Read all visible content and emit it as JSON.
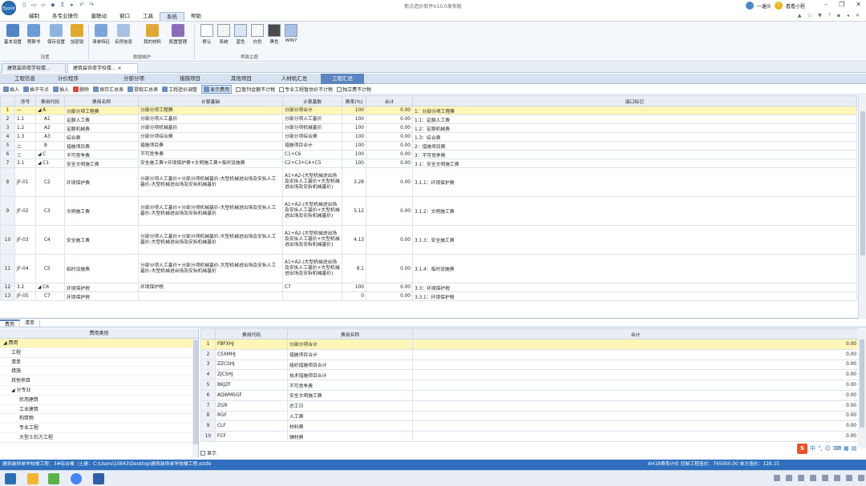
{
  "window": {
    "title": "新点造价软件V10.0发布版",
    "logo_text": "Epoint",
    "user_name": "一遍头",
    "help_label": "看看小程",
    "qat_icons": [
      "new-icon",
      "open-icon",
      "folder-icon",
      "save-icon",
      "sigma-icon",
      "export-icon",
      "undo-icon",
      "redo-icon"
    ]
  },
  "menu": {
    "items": [
      {
        "label": "编制",
        "active": false
      },
      {
        "label": "各专业操作",
        "active": false
      },
      {
        "label": "量联动",
        "active": false
      },
      {
        "label": "窗口",
        "active": false
      },
      {
        "label": "工具",
        "active": false
      },
      {
        "label": "系统",
        "active": true
      },
      {
        "label": "帮助",
        "active": false
      }
    ],
    "right": [
      "▲",
      "◇",
      "▼",
      "?",
      "▪",
      "◂",
      "✕"
    ]
  },
  "ribbon": {
    "groups": [
      {
        "label": "设置",
        "buttons": [
          "基本设置",
          "预算书",
          "保存设置",
          "加密锁"
        ]
      },
      {
        "label": "数据维护",
        "buttons": [
          "清单特征",
          "名称信息",
          "我的材料",
          "配置管理"
        ]
      },
      {
        "label": "界面主题",
        "buttons": [
          "默认",
          "系统",
          "蓝色",
          "白色",
          "黑色",
          "WIN7"
        ]
      }
    ],
    "theme_colors": [
      "#ffffff",
      "#f3f3f3",
      "#dbe6f4",
      "#f7f7f7",
      "#4a4a4a",
      "#a9c3e8"
    ]
  },
  "doc_tabs": [
    {
      "label": "建筑装饰单学校楼...",
      "active": false
    },
    {
      "label": "建筑装饰单学校楼...",
      "active": true,
      "close": "×"
    }
  ],
  "sub_tabs": [
    {
      "label": "工程信息",
      "active": false
    },
    {
      "label": "计价程序",
      "active": false
    },
    {
      "label": "分部分项",
      "active": false
    },
    {
      "label": "措施项目",
      "active": false
    },
    {
      "label": "其他项目",
      "active": false
    },
    {
      "label": "人材机汇总",
      "active": false
    },
    {
      "label": "工程汇总",
      "active": true
    }
  ],
  "toolbar2": {
    "buttons": [
      "插入",
      "插子节点",
      "插入",
      "删除",
      "保存汇总表",
      "提取汇总表",
      "工程造价调整",
      "显示费用"
    ],
    "checks": [
      "暂列金额不计税",
      "专业工程暂估价不计税",
      "独立费不计税"
    ]
  },
  "summary_grid": {
    "headers": [
      "序号",
      "费用代码",
      "费用名称",
      "计算基础",
      "计算基数",
      "费率(%)",
      "合计",
      "接口标记"
    ],
    "rows": [
      {
        "rn": "1",
        "seq": "—",
        "code": "◢ A",
        "name": "分部分项工程费",
        "basis": "分部分项工程费",
        "base": "分部分项合计",
        "rate": "100",
        "total": "0.00",
        "mark": "1：分部分项工程费",
        "sel": true,
        "tall": false
      },
      {
        "rn": "2",
        "seq": "1.1",
        "code": "A1",
        "name": "定额人工费",
        "basis": "分部分项人工基价",
        "base": "分部分项人工基价",
        "rate": "100",
        "total": "0.00",
        "mark": "1.1：定额人工费",
        "sel": false,
        "tall": false
      },
      {
        "rn": "3",
        "seq": "1.2",
        "code": "A2",
        "name": "定额机械费",
        "basis": "分部分项机械基价",
        "base": "分部分项机械基价",
        "rate": "100",
        "total": "0.00",
        "mark": "1.2：定额机械费",
        "sel": false,
        "tall": false
      },
      {
        "rn": "4",
        "seq": "1.3",
        "code": "A3",
        "name": "综合费",
        "basis": "分部分项综合费",
        "base": "分部分项综合费",
        "rate": "100",
        "total": "0.00",
        "mark": "1.3：综合费",
        "sel": false,
        "tall": false
      },
      {
        "rn": "5",
        "seq": "二",
        "code": "B",
        "name": "措施项目费",
        "basis": "措施项目费",
        "base": "措施项目合计",
        "rate": "100",
        "total": "0.00",
        "mark": "2：措施项目费",
        "sel": false,
        "tall": false
      },
      {
        "rn": "6",
        "seq": "三",
        "code": "◢ C",
        "name": "不可竞争费",
        "basis": "不可竞争费",
        "base": "C1+C6",
        "rate": "100",
        "total": "0.00",
        "mark": "3：不可竞争费",
        "sel": false,
        "tall": false
      },
      {
        "rn": "7",
        "seq": "3.1",
        "code": "◢ C1",
        "name": "安全文明施工费",
        "basis": "安全施工费+环境保护费+文明施工费+临时设施费",
        "base": "C2+C3+C4+C5",
        "rate": "100",
        "total": "0.00",
        "mark": "3.1：安全文明施工费",
        "sel": false,
        "tall": false
      },
      {
        "rn": "8",
        "seq": "JF-01",
        "code": "C2",
        "name": "环境保护费",
        "basis": "分部分项人工基价+分部分项机械基价-大型机械进出场及安拆人工基价-大型机械进出场及安拆机械基价",
        "base": "A1+A2-(大型机械进出场及安拆人工基价+大型机械进出场及安拆机械基价)",
        "rate": "3.28",
        "total": "0.00",
        "mark": "3.1.1：环境保护费",
        "sel": false,
        "tall": true
      },
      {
        "rn": "9",
        "seq": "JF-02",
        "code": "C3",
        "name": "文明施工费",
        "basis": "分部分项人工基价+分部分项机械基价-大型机械进出场及安拆人工基价-大型机械进出场及安拆机械基价",
        "base": "A1+A2-(大型机械进出场及安拆人工基价+大型机械进出场及安拆机械基价)",
        "rate": "5.12",
        "total": "0.00",
        "mark": "3.1.2：文明施工费",
        "sel": false,
        "tall": true
      },
      {
        "rn": "10",
        "seq": "JF-03",
        "code": "C4",
        "name": "安全施工费",
        "basis": "分部分项人工基价+分部分项机械基价-大型机械进出场及安拆人工基价-大型机械进出场及安拆机械基价",
        "base": "A1+A2-(大型机械进出场及安拆人工基价+大型机械进出场及安拆机械基价)",
        "rate": "4.13",
        "total": "0.00",
        "mark": "3.1.3：安全施工费",
        "sel": false,
        "tall": true
      },
      {
        "rn": "11",
        "seq": "JF-04",
        "code": "C5",
        "name": "临时设施费",
        "basis": "分部分项人工基价+分部分项机械基价-大型机械进出场及安拆人工基价-大型机械进出场及安拆机械基价",
        "base": "A1+A2-(大型机械进出场及安拆人工基价+大型机械进出场及安拆机械基价)",
        "rate": "8.1",
        "total": "0.00",
        "mark": "3.1.4：临时设施费",
        "sel": false,
        "tall": true
      },
      {
        "rn": "12",
        "seq": "3.2",
        "code": "◢ C6",
        "name": "环境保护税",
        "basis": "环境保护税",
        "base": "C7",
        "rate": "100",
        "total": "0.00",
        "mark": "3.3：环境保护税",
        "sel": false,
        "tall": false
      },
      {
        "rn": "13",
        "seq": "JF-05",
        "code": "C7",
        "name": "环境保护税",
        "basis": "",
        "base": "",
        "rate": "0",
        "total": "0.00",
        "mark": "3.3.1：环境保护税",
        "sel": false,
        "tall": false
      }
    ]
  },
  "bottom_tabs": [
    {
      "label": "费用",
      "active": true
    },
    {
      "label": "清单",
      "active": false
    }
  ],
  "cost_tree": {
    "header": "费用类别",
    "items": [
      {
        "label": "◢ 费用",
        "indent": 0,
        "sel": true
      },
      {
        "label": "工程",
        "indent": 1,
        "sel": false
      },
      {
        "label": "清单",
        "indent": 1,
        "sel": false
      },
      {
        "label": "措施",
        "indent": 1,
        "sel": false
      },
      {
        "label": "其他项目",
        "indent": 1,
        "sel": false
      },
      {
        "label": "◢ 分专业",
        "indent": 1,
        "sel": false
      },
      {
        "label": "民用建筑",
        "indent": 2,
        "sel": false
      },
      {
        "label": "工业建筑",
        "indent": 2,
        "sel": false
      },
      {
        "label": "构筑物",
        "indent": 2,
        "sel": false
      },
      {
        "label": "专业工程",
        "indent": 2,
        "sel": false
      },
      {
        "label": "大型土石方工程",
        "indent": 2,
        "sel": false
      }
    ],
    "footer_check": "显示"
  },
  "cost_codes": {
    "headers": [
      "",
      "费用代码",
      "费用名称",
      "合计"
    ],
    "rows": [
      {
        "rn": "1",
        "code": "FBFXHJ",
        "name": "分部分项合计",
        "total": "0.00",
        "sel": true
      },
      {
        "rn": "2",
        "code": "CSXMHJ",
        "name": "措施项目合计",
        "total": "0.00",
        "sel": false
      },
      {
        "rn": "3",
        "code": "ZZCSHJ",
        "name": "组织措施项目合计",
        "total": "0.00",
        "sel": false
      },
      {
        "rn": "4",
        "code": "ZJCSHJ",
        "name": "技术措施项目合计",
        "total": "0.00",
        "sel": false
      },
      {
        "rn": "5",
        "code": "BKJZF",
        "name": "不可竞争费",
        "total": "0.00",
        "sel": false
      },
      {
        "rn": "6",
        "code": "AQWMSGF",
        "name": "安全文明施工费",
        "total": "0.00",
        "sel": false
      },
      {
        "rn": "7",
        "code": "ZGR",
        "name": "总工日",
        "total": "0.00",
        "sel": false
      },
      {
        "rn": "8",
        "code": "RGF",
        "name": "人工费",
        "total": "0.00",
        "sel": false
      },
      {
        "rn": "9",
        "code": "CLF",
        "name": "材料费",
        "total": "0.00",
        "sel": false
      },
      {
        "rn": "10",
        "code": "FCF",
        "name": "辅材费",
        "total": "0.00",
        "sel": false
      }
    ]
  },
  "ime": {
    "logo": "S",
    "items": [
      "中",
      "°,",
      "☺",
      "⌨",
      "▦",
      "▤"
    ]
  },
  "status": {
    "left": "建筑装饰单学校楼工程：3#综合楼（土建：C:\\Users\\10843\\Desktop\\建筑装饰单学校楼工程.ezsfe",
    "right": "AH18费率计价 控制工程造价：765000.00 单方造价：128.15"
  },
  "taskbar": {
    "colors": {
      "start": "#2a6fb5",
      "explorer": "#f2b632",
      "app1": "#5ab24b",
      "chrome": "#4285f4",
      "app2": "#2f5fa8"
    }
  }
}
